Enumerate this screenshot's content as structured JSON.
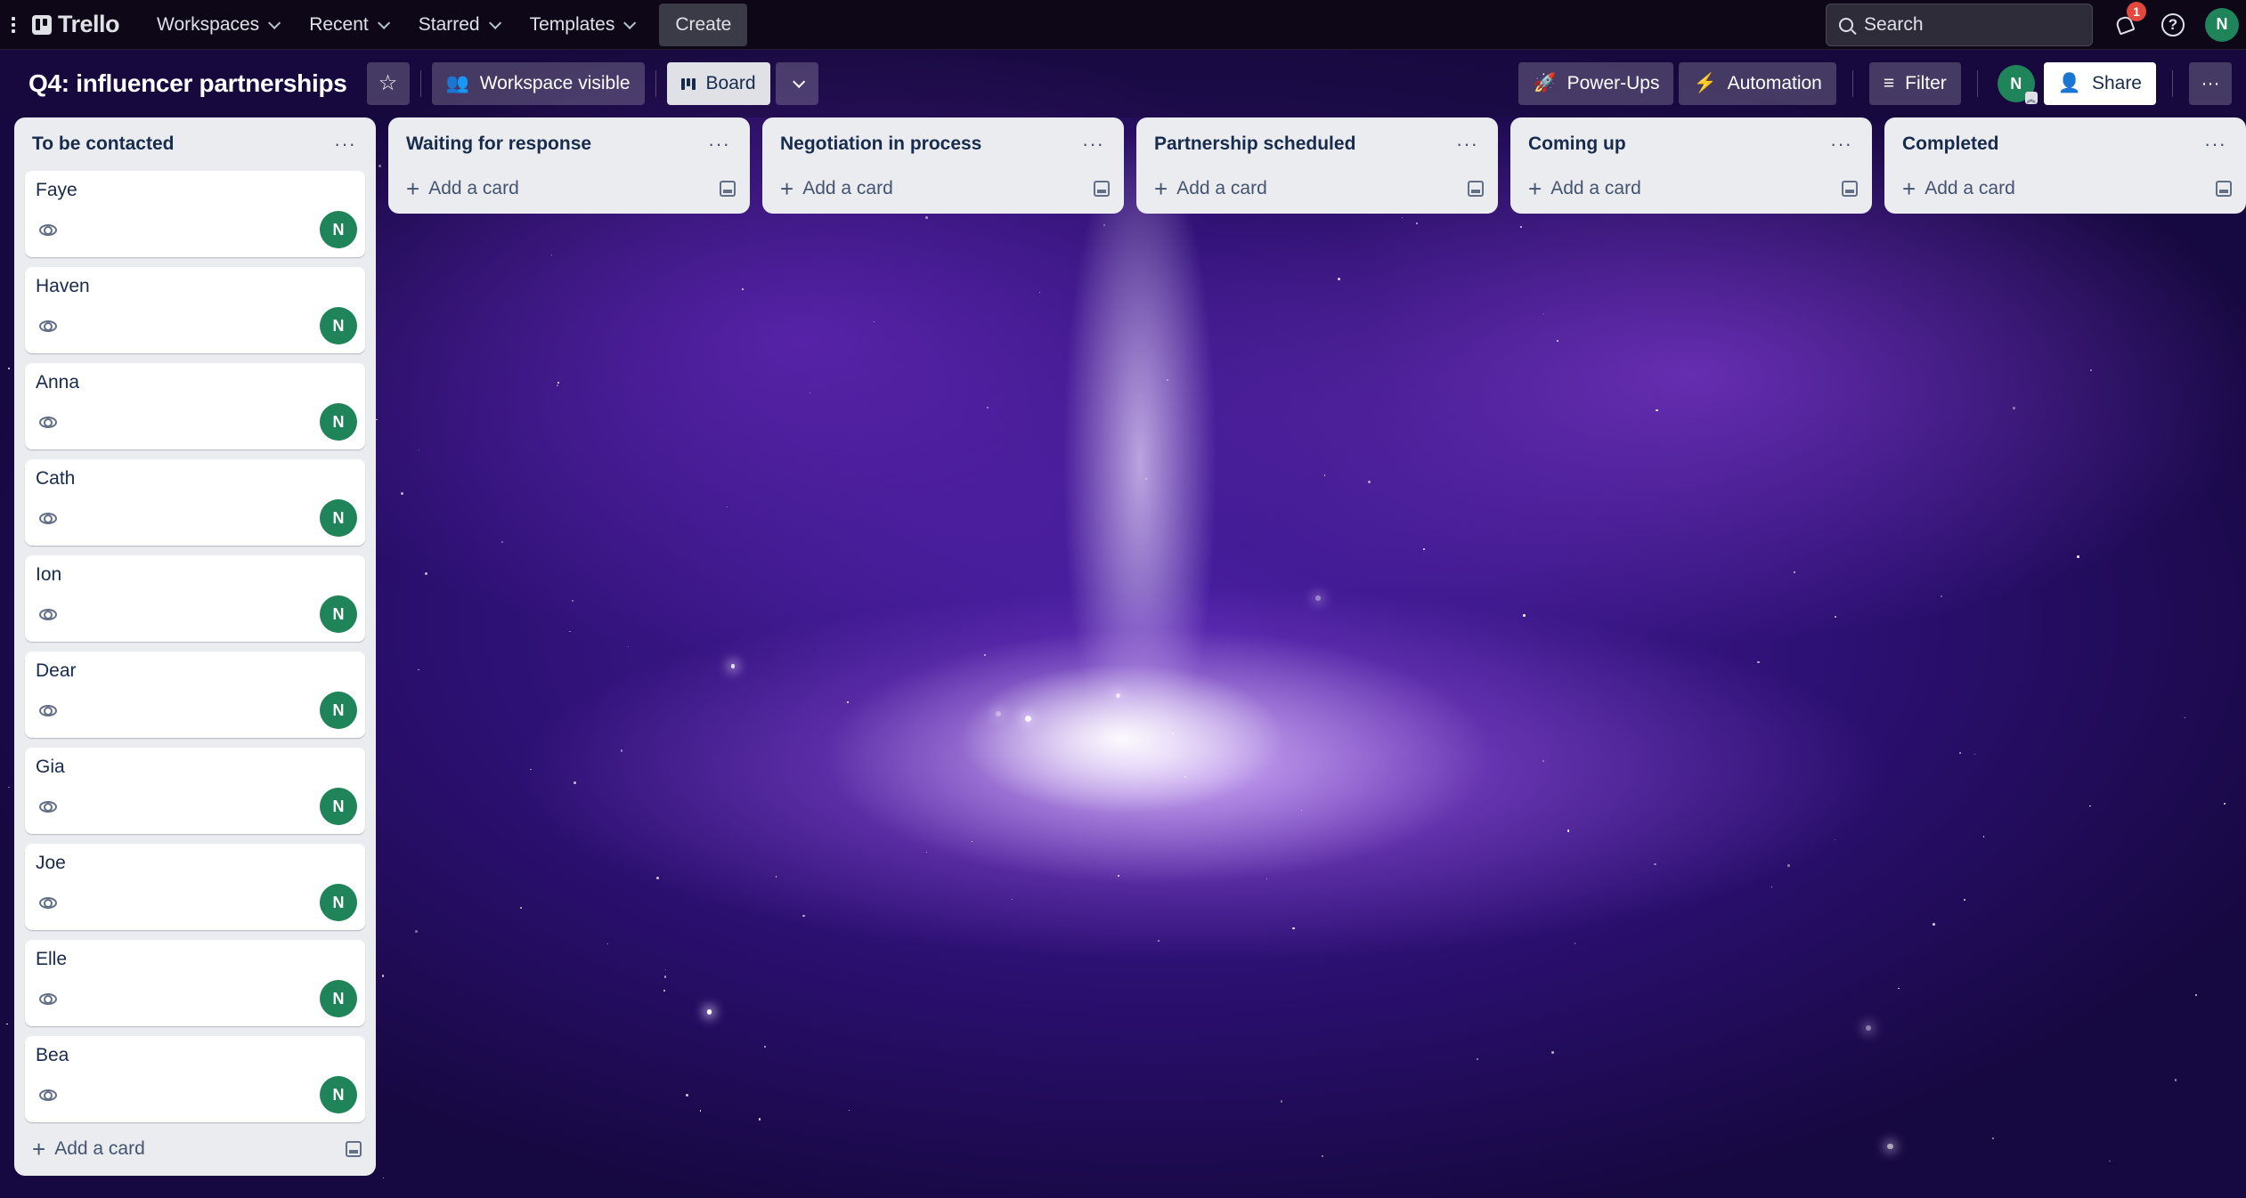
{
  "topbar": {
    "brand": "Trello",
    "nav": [
      {
        "label": "Workspaces"
      },
      {
        "label": "Recent"
      },
      {
        "label": "Starred"
      },
      {
        "label": "Templates"
      }
    ],
    "create_label": "Create",
    "search_placeholder": "Search",
    "notification_count": "1",
    "help_glyph": "?",
    "user_initial": "N"
  },
  "board": {
    "title": "Q4: influencer partnerships",
    "star_glyph": "☆",
    "visibility_label": "Workspace visible",
    "view_label": "Board",
    "powerups_label": "Power-Ups",
    "automation_label": "Automation",
    "filter_label": "Filter",
    "member_initial": "N",
    "share_label": "Share",
    "more_glyph": "···"
  },
  "icons": {
    "list_menu": "···",
    "plus": "+",
    "powerups": "🚀",
    "automation": "⚡",
    "filter": "≡",
    "share": "👤",
    "visibility": "👥"
  },
  "lists": [
    {
      "title": "To be contacted",
      "add_label": "Add a card",
      "cards": [
        {
          "title": "Faye",
          "member": "N"
        },
        {
          "title": "Haven",
          "member": "N"
        },
        {
          "title": "Anna",
          "member": "N"
        },
        {
          "title": "Cath",
          "member": "N"
        },
        {
          "title": "Ion",
          "member": "N"
        },
        {
          "title": "Dear",
          "member": "N"
        },
        {
          "title": "Gia",
          "member": "N"
        },
        {
          "title": "Joe",
          "member": "N"
        },
        {
          "title": "Elle",
          "member": "N"
        },
        {
          "title": "Bea",
          "member": "N"
        }
      ]
    },
    {
      "title": "Waiting for response",
      "add_label": "Add a card",
      "cards": []
    },
    {
      "title": "Negotiation in process",
      "add_label": "Add a card",
      "cards": []
    },
    {
      "title": "Partnership scheduled",
      "add_label": "Add a card",
      "cards": []
    },
    {
      "title": "Coming up",
      "add_label": "Add a card",
      "cards": []
    },
    {
      "title": "Completed",
      "add_label": "Add a card",
      "cards": []
    }
  ],
  "colors": {
    "member_avatar": "#1f845a",
    "notification_badge": "#e2483d",
    "header_bg": "#0d0718",
    "list_bg": "#ebecf0"
  }
}
